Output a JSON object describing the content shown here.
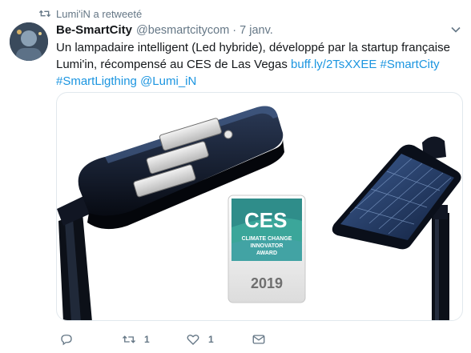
{
  "retweet_notice": {
    "text": "Lumi'iN a retweeté"
  },
  "author": {
    "name": "Be-SmartCity",
    "handle": "@besmartcitycom",
    "separator": "·",
    "time": "7 janv."
  },
  "tweet": {
    "text_part1": "Un lampadaire intelligent (Led hybride), développé par la startup française Lumi'in, récompensé au CES de Las Vegas",
    "link_url": "buff.ly/2TsXXEE",
    "hashtag1": "#SmartCity",
    "hashtag2": "#SmartLigthing",
    "mention": "@Lumi_iN"
  },
  "media": {
    "badge": {
      "logo": "CES",
      "line1": "CLIMATE CHANGE",
      "line2": "INNOVATOR",
      "line3": "AWARD",
      "year": "2019"
    }
  },
  "actions": {
    "reply_count": "",
    "retweet_count": "1",
    "like_count": "1"
  },
  "colors": {
    "link": "#1b95e0",
    "secondary_text": "#657786",
    "border": "#e1e8ed"
  }
}
